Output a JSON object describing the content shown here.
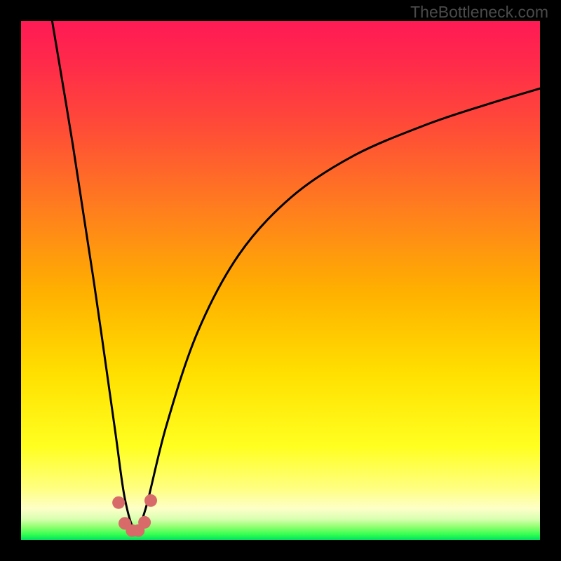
{
  "watermark": "TheBottleneck.com",
  "chart_data": {
    "type": "line",
    "title": "",
    "xlabel": "",
    "ylabel": "",
    "xlim": [
      0,
      100
    ],
    "ylim": [
      0,
      100
    ],
    "note": "Axes are unlabeled percentage-like scales; curve shows a bottleneck V-curve with minimum near x≈22, value≈2. Left branch starts near (6,100) and descends to the valley; right branch rises from the valley toward (100,≈87).",
    "series": [
      {
        "name": "bottleneck-curve",
        "x": [
          6,
          10,
          14,
          18,
          20,
          22,
          24,
          28,
          34,
          42,
          52,
          64,
          78,
          90,
          100
        ],
        "y": [
          100,
          76,
          50,
          22,
          8,
          2,
          6,
          22,
          40,
          55,
          66,
          74,
          80,
          84,
          87
        ]
      }
    ],
    "markers": {
      "name": "valley-markers",
      "color": "#d86a6a",
      "points_x": [
        18.8,
        20.0,
        21.4,
        22.6,
        23.8,
        25.0
      ],
      "points_y": [
        7.2,
        3.2,
        1.8,
        1.8,
        3.4,
        7.6
      ]
    },
    "gradient_stops": [
      {
        "pos": 0.0,
        "color": "#ff1a55"
      },
      {
        "pos": 0.35,
        "color": "#ff7a20"
      },
      {
        "pos": 0.7,
        "color": "#ffe000"
      },
      {
        "pos": 0.92,
        "color": "#ffff80"
      },
      {
        "pos": 1.0,
        "color": "#00e060"
      }
    ]
  }
}
